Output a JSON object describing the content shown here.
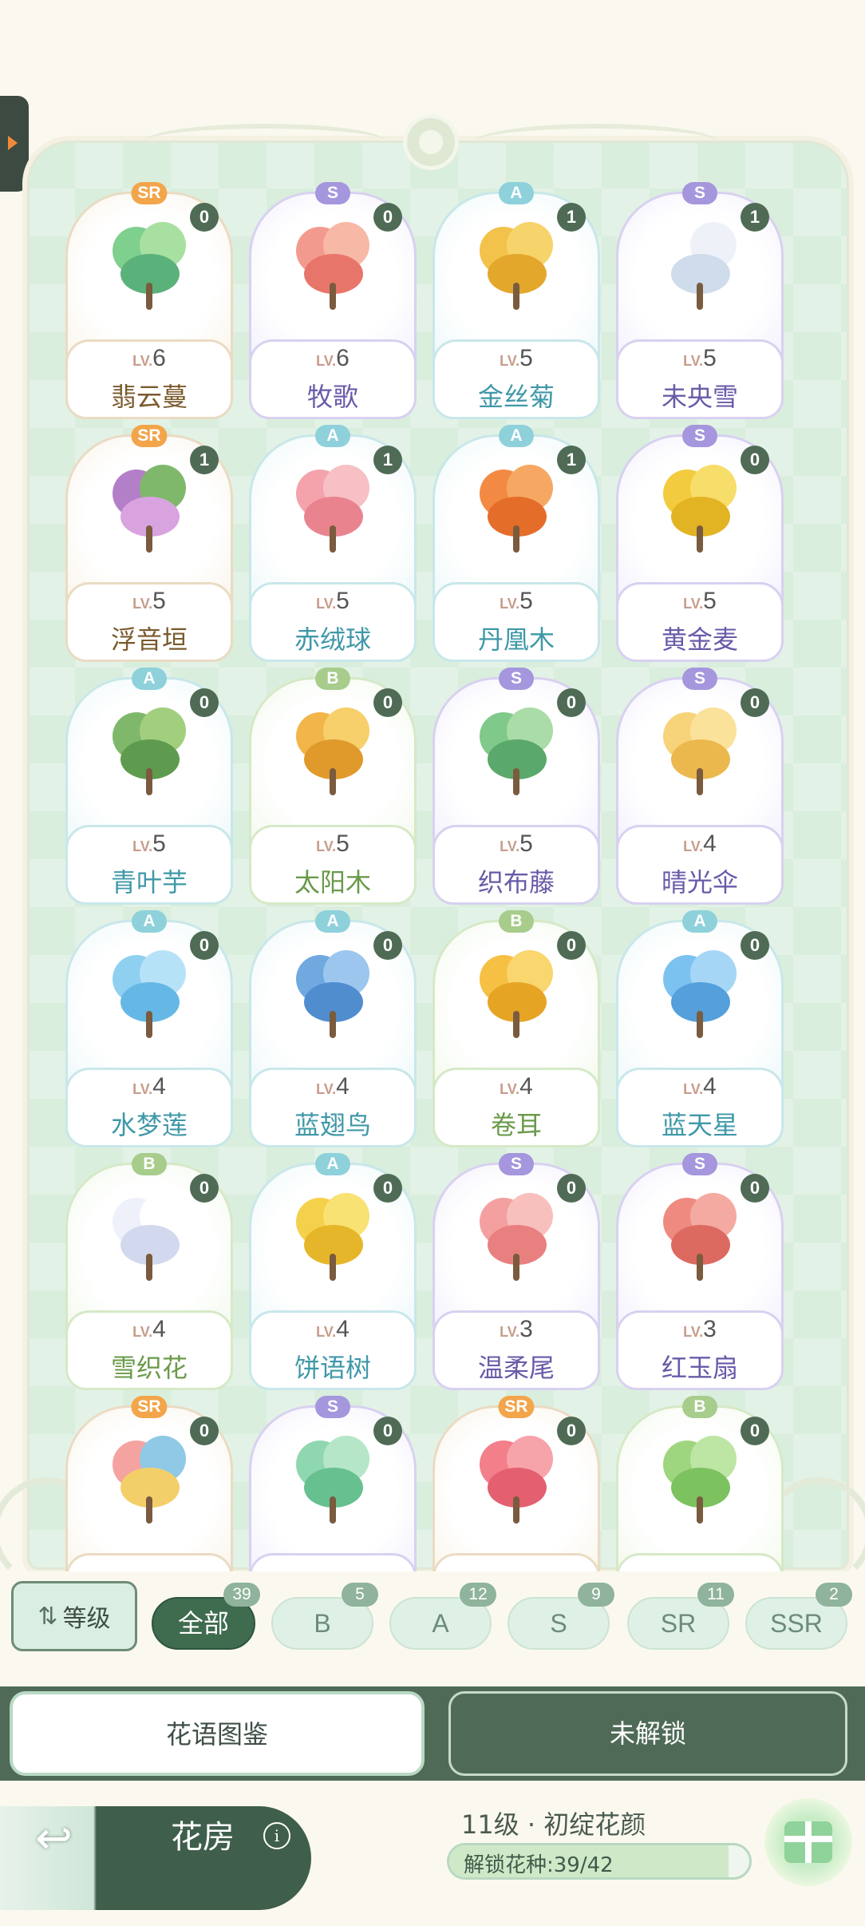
{
  "cards": [
    {
      "rarity": "SR",
      "count": "0",
      "lv": "LV.",
      "level": "6",
      "name": "翡云蔓",
      "cls": "sr",
      "plant": [
        "#7fcf8e",
        "#a7e0a0",
        "#5ab27a"
      ]
    },
    {
      "rarity": "S",
      "count": "0",
      "lv": "LV.",
      "level": "6",
      "name": "牧歌",
      "cls": "s",
      "plant": [
        "#f39a8f",
        "#f7b8a6",
        "#e8756a"
      ]
    },
    {
      "rarity": "A",
      "count": "1",
      "lv": "LV.",
      "level": "5",
      "name": "金丝菊",
      "cls": "a",
      "plant": [
        "#f2c24a",
        "#f7d46b",
        "#e3a72c"
      ]
    },
    {
      "rarity": "S",
      "count": "1",
      "lv": "LV.",
      "level": "5",
      "name": "未央雪",
      "cls": "s",
      "plant": [
        "#ffffff",
        "#eef2f8",
        "#cfdcec"
      ]
    },
    {
      "rarity": "SR",
      "count": "1",
      "lv": "LV.",
      "level": "5",
      "name": "浮音垣",
      "cls": "sr",
      "plant": [
        "#b47fc9",
        "#7fb86a",
        "#d9a3df"
      ]
    },
    {
      "rarity": "A",
      "count": "1",
      "lv": "LV.",
      "level": "5",
      "name": "赤绒球",
      "cls": "a",
      "plant": [
        "#f4a3ad",
        "#f7c0c4",
        "#e9848f"
      ]
    },
    {
      "rarity": "A",
      "count": "1",
      "lv": "LV.",
      "level": "5",
      "name": "丹凰木",
      "cls": "a",
      "plant": [
        "#f28a43",
        "#f6a863",
        "#e46d2a"
      ]
    },
    {
      "rarity": "S",
      "count": "0",
      "lv": "LV.",
      "level": "5",
      "name": "黄金麦",
      "cls": "s",
      "plant": [
        "#f2cc3e",
        "#f7dd6a",
        "#e2b323"
      ]
    },
    {
      "rarity": "A",
      "count": "0",
      "lv": "LV.",
      "level": "5",
      "name": "青叶芋",
      "cls": "a",
      "plant": [
        "#7fb86a",
        "#a2cf7e",
        "#5f9b4e"
      ]
    },
    {
      "rarity": "B",
      "count": "0",
      "lv": "LV.",
      "level": "5",
      "name": "太阳木",
      "cls": "b",
      "plant": [
        "#f2b54a",
        "#f7cf6b",
        "#e09a2c"
      ]
    },
    {
      "rarity": "S",
      "count": "0",
      "lv": "LV.",
      "level": "5",
      "name": "织布藤",
      "cls": "s",
      "plant": [
        "#7fc98a",
        "#a9dca6",
        "#5aa86b"
      ]
    },
    {
      "rarity": "S",
      "count": "0",
      "lv": "LV.",
      "level": "4",
      "name": "晴光伞",
      "cls": "s",
      "plant": [
        "#f7d479",
        "#fae29b",
        "#eab84d"
      ]
    },
    {
      "rarity": "A",
      "count": "0",
      "lv": "LV.",
      "level": "4",
      "name": "水梦莲",
      "cls": "a",
      "plant": [
        "#8fd0f0",
        "#b6e2f7",
        "#65b8e6"
      ]
    },
    {
      "rarity": "A",
      "count": "0",
      "lv": "LV.",
      "level": "4",
      "name": "蓝翅鸟",
      "cls": "a",
      "plant": [
        "#6fa9e0",
        "#9cc6ee",
        "#4f8dcf"
      ]
    },
    {
      "rarity": "B",
      "count": "0",
      "lv": "LV.",
      "level": "4",
      "name": "卷耳",
      "cls": "b",
      "plant": [
        "#f5c043",
        "#f9d66e",
        "#e6a425"
      ]
    },
    {
      "rarity": "A",
      "count": "0",
      "lv": "LV.",
      "level": "4",
      "name": "蓝天星",
      "cls": "a",
      "plant": [
        "#7cc2f0",
        "#a6d6f6",
        "#549fdc"
      ]
    },
    {
      "rarity": "B",
      "count": "0",
      "lv": "LV.",
      "level": "4",
      "name": "雪织花",
      "cls": "b",
      "plant": [
        "#eef1fa",
        "#ffffff",
        "#d2d9ee"
      ]
    },
    {
      "rarity": "A",
      "count": "0",
      "lv": "LV.",
      "level": "4",
      "name": "饼语树",
      "cls": "a",
      "plant": [
        "#f5d04a",
        "#f9e274",
        "#e6b62a"
      ]
    },
    {
      "rarity": "S",
      "count": "0",
      "lv": "LV.",
      "level": "3",
      "name": "温柔尾",
      "cls": "s",
      "plant": [
        "#f4a0a0",
        "#f8c0bd",
        "#e98080"
      ]
    },
    {
      "rarity": "S",
      "count": "0",
      "lv": "LV.",
      "level": "3",
      "name": "红玉扇",
      "cls": "s",
      "plant": [
        "#ee8a80",
        "#f4aaa0",
        "#dc6a60"
      ]
    },
    {
      "rarity": "SR",
      "count": "0",
      "lv": "",
      "level": "",
      "name": "",
      "cls": "sr",
      "plant": [
        "#f5a3a0",
        "#8fc9e6",
        "#f3cf6a"
      ]
    },
    {
      "rarity": "S",
      "count": "0",
      "lv": "",
      "level": "",
      "name": "",
      "cls": "s",
      "plant": [
        "#8fd7b0",
        "#b5e6c7",
        "#66c090"
      ]
    },
    {
      "rarity": "SR",
      "count": "0",
      "lv": "",
      "level": "",
      "name": "",
      "cls": "sr",
      "plant": [
        "#f27f8a",
        "#f7a3aa",
        "#e46070"
      ]
    },
    {
      "rarity": "B",
      "count": "0",
      "lv": "",
      "level": "",
      "name": "",
      "cls": "b",
      "plant": [
        "#9ed67f",
        "#bde5a4",
        "#7cc25f"
      ]
    }
  ],
  "filters": {
    "sort_label": "等级",
    "chips": [
      {
        "label": "全部",
        "badge": "39",
        "active": true
      },
      {
        "label": "B",
        "badge": "5",
        "active": false
      },
      {
        "label": "A",
        "badge": "12",
        "active": false
      },
      {
        "label": "S",
        "badge": "9",
        "active": false
      },
      {
        "label": "SR",
        "badge": "11",
        "active": false
      },
      {
        "label": "SSR",
        "badge": "2",
        "active": false
      }
    ]
  },
  "tabs": {
    "active": "花语图鉴",
    "inactive": "未解锁"
  },
  "footer": {
    "room_label": "花房",
    "info_glyph": "i",
    "garden_level": "11级 · 初绽花颜",
    "unlock_label": "解锁花种:39/42",
    "unlock_fraction": 0.93
  }
}
